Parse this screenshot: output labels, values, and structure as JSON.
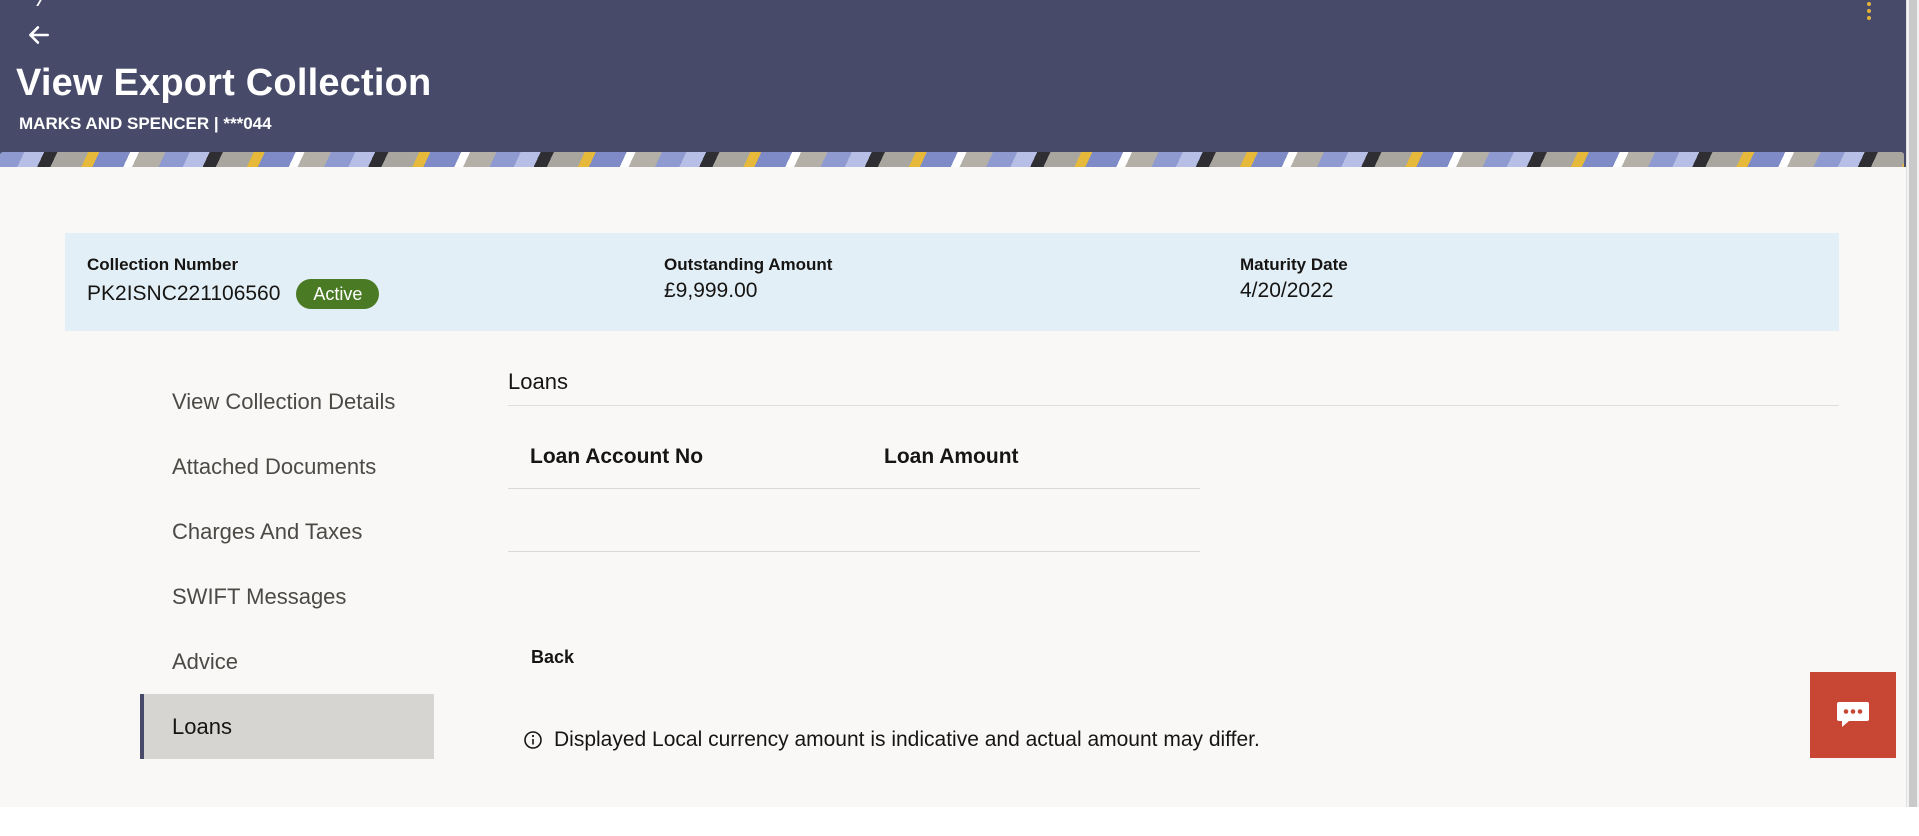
{
  "header": {
    "title": "View Export Collection",
    "subtitle": "MARKS AND SPENCER | ***044"
  },
  "summary": {
    "collection_number_label": "Collection Number",
    "collection_number": "PK2ISNC221106560",
    "status": "Active",
    "outstanding_label": "Outstanding Amount",
    "outstanding_value": "£9,999.00",
    "maturity_label": "Maturity Date",
    "maturity_value": "4/20/2022"
  },
  "sidenav": {
    "items": [
      {
        "label": "View Collection Details",
        "active": false
      },
      {
        "label": "Attached Documents",
        "active": false
      },
      {
        "label": "Charges And Taxes",
        "active": false
      },
      {
        "label": "SWIFT Messages",
        "active": false
      },
      {
        "label": "Advice",
        "active": false
      },
      {
        "label": "Loans",
        "active": true
      }
    ]
  },
  "loans": {
    "section_title": "Loans",
    "columns": [
      "Loan Account No",
      "Loan Amount"
    ],
    "rows": []
  },
  "actions": {
    "back_label": "Back"
  },
  "note": {
    "text": "Displayed Local currency amount is indicative and actual amount may differ."
  },
  "colors": {
    "header_bg": "#474b69",
    "status_badge": "#4a7a23",
    "chat_button": "#c74634",
    "summary_bg": "#e2eff6",
    "kebab": "#e3b23c"
  },
  "icons": {
    "back": "back-arrow-icon",
    "menu": "kebab-menu-icon",
    "info": "info-icon",
    "chat": "chat-bubble-icon"
  }
}
